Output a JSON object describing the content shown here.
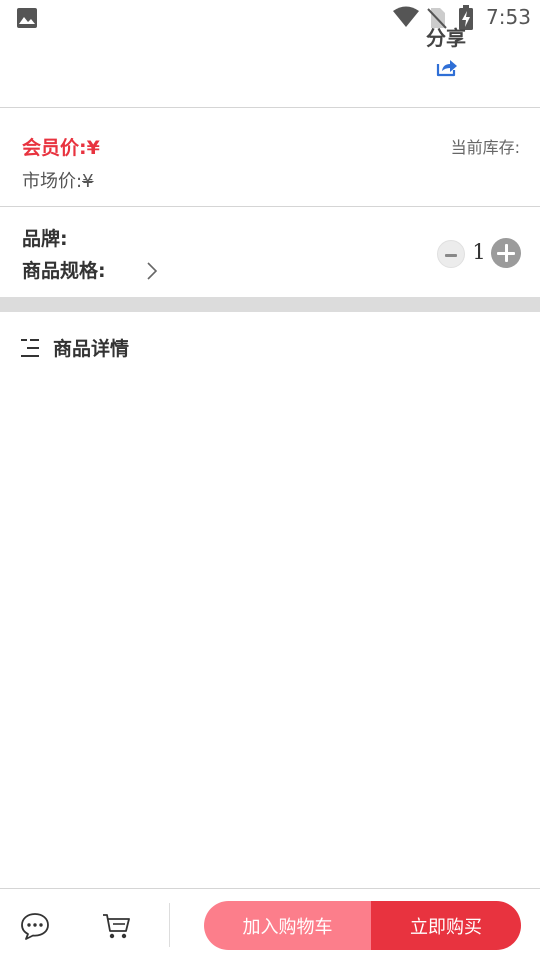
{
  "status_bar": {
    "time": "7:53",
    "icons": [
      "photo-icon",
      "wifi-icon",
      "no-sim-icon",
      "battery-charging-icon"
    ]
  },
  "header": {
    "share_label": "分享",
    "share_icon": "share-arrow-icon",
    "share_icon_color": "#2f6fd6"
  },
  "price": {
    "member_label": "会员价:",
    "member_value": "¥",
    "market_label": "市场价:",
    "market_value": "¥",
    "stock_label": "当前库存:"
  },
  "product": {
    "brand_label": "品牌:",
    "spec_label": "商品规格:",
    "quantity": "1"
  },
  "details": {
    "title": "商品详情",
    "icon": "list-menu-icon"
  },
  "bottom_bar": {
    "chat_icon": "chat-bubble-icon",
    "cart_icon": "shopping-cart-icon",
    "add_to_cart_label": "加入购物车",
    "buy_now_label": "立即购买"
  },
  "colors": {
    "accent_red": "#e8333f",
    "add_cart_pink": "#fc7e8b",
    "divider_gray": "#d5d5d5",
    "band_gray": "#dcdcdc"
  }
}
